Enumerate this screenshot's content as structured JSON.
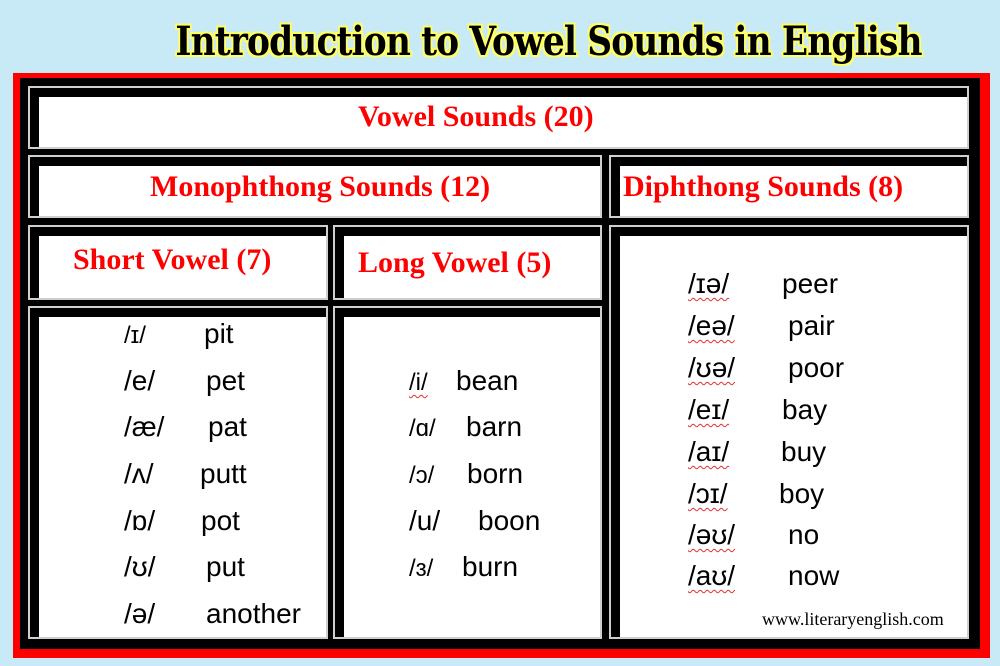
{
  "page": {
    "title": "Introduction to Vowel Sounds in English",
    "footer_url": "www.literaryenglish.com",
    "colors": {
      "background": "#c8eaf6",
      "frame": "#ff0000",
      "header_text": "#ff0000",
      "title_outline": "#ffff66"
    }
  },
  "table": {
    "root_header": "Vowel Sounds (20)",
    "monophthong_header": "Monophthong Sounds (12)",
    "diphthong_header": "Diphthong Sounds (8)",
    "short_header": "Short Vowel (7)",
    "long_header": "Long Vowel (5)",
    "short_vowels": [
      {
        "symbol": "/ɪ/",
        "word": "pit"
      },
      {
        "symbol": "/e/",
        "word": "pet"
      },
      {
        "symbol": "/æ/",
        "word": "pat"
      },
      {
        "symbol": "/ʌ/",
        "word": "putt"
      },
      {
        "symbol": "/ɒ/",
        "word": "pot"
      },
      {
        "symbol": "/ʊ/",
        "word": "put"
      },
      {
        "symbol": "/ə/",
        "word": "another"
      }
    ],
    "long_vowels": [
      {
        "symbol": "/i/",
        "word": "bean"
      },
      {
        "symbol": "/ɑ/",
        "word": "barn"
      },
      {
        "symbol": "/ɔ/",
        "word": "born"
      },
      {
        "symbol": "/u/",
        "word": "boon"
      },
      {
        "symbol": "/ɜ/",
        "word": "burn"
      }
    ],
    "diphthongs": [
      {
        "symbol": "/ɪə/",
        "word": "peer"
      },
      {
        "symbol": "/eə/",
        "word": "pair"
      },
      {
        "symbol": "/ʊə/",
        "word": "poor"
      },
      {
        "symbol": "/eɪ/",
        "word": "bay"
      },
      {
        "symbol": "/aɪ/",
        "word": "buy"
      },
      {
        "symbol": "/ɔɪ/",
        "word": "boy"
      },
      {
        "symbol": "/əʊ/",
        "word": "no"
      },
      {
        "symbol": "/aʊ/",
        "word": "now"
      }
    ]
  }
}
